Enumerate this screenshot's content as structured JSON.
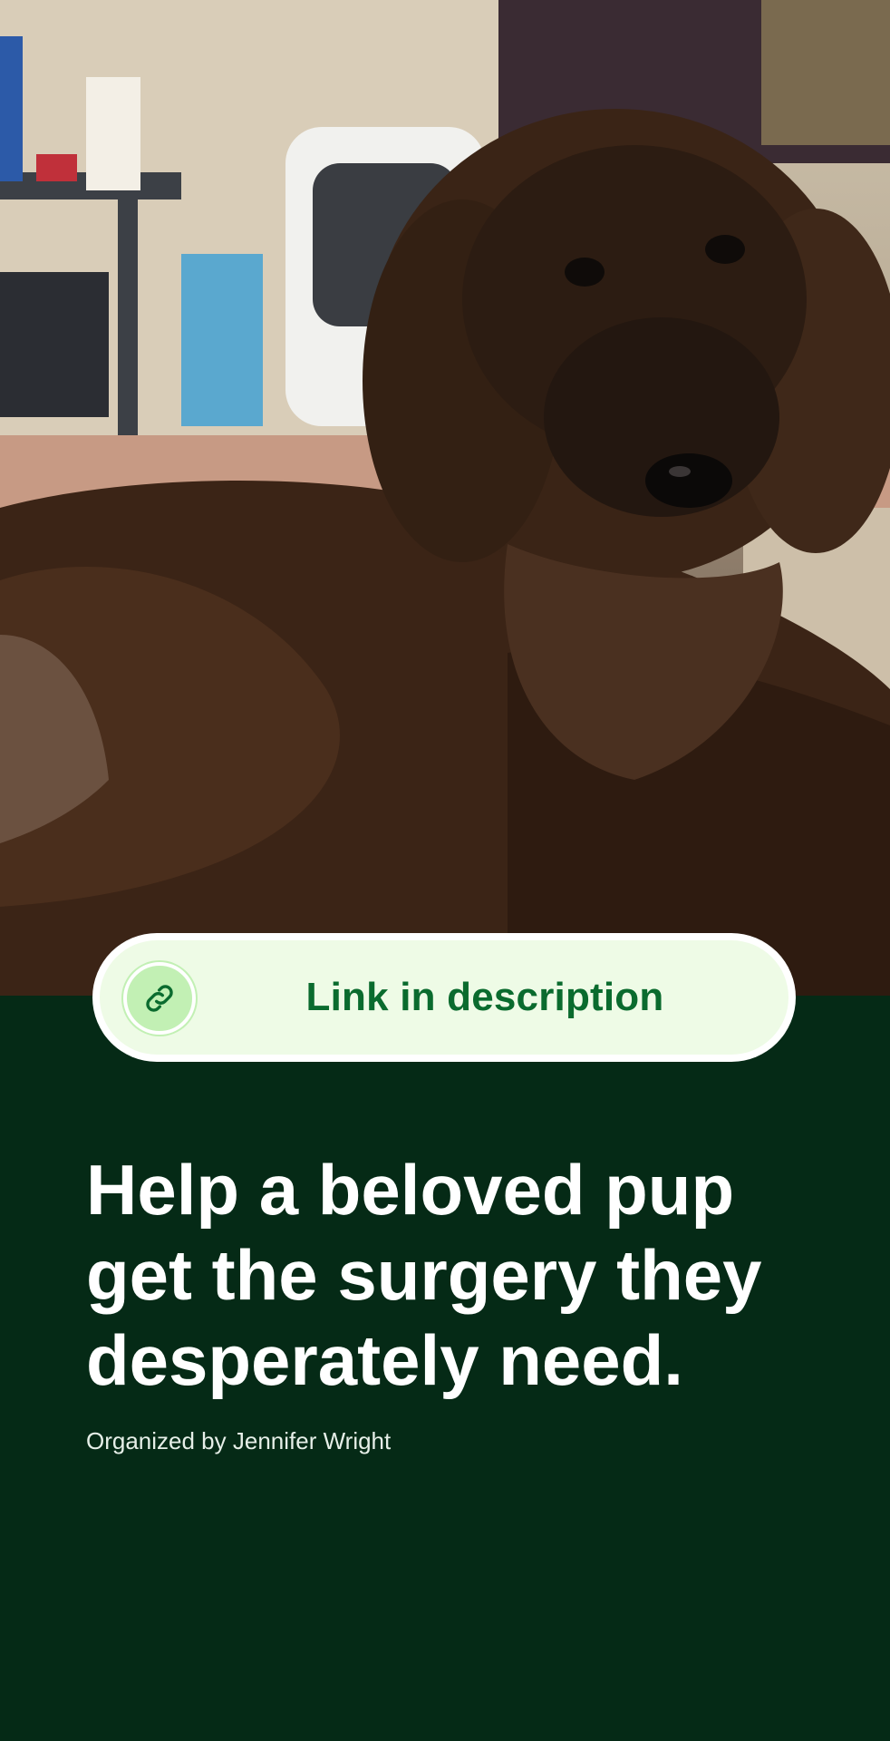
{
  "campaign": {
    "photo_subject": "dog-photo",
    "link_pill": {
      "icon": "link-icon",
      "label": "Link in description",
      "accent_color": "#0a6b2e",
      "icon_bg_color": "#c2f0b4"
    },
    "title": "Help a beloved pup get the surgery they desperately need.",
    "organizer": "Organized by Jennifer Wright",
    "background_color": "#052a16"
  }
}
